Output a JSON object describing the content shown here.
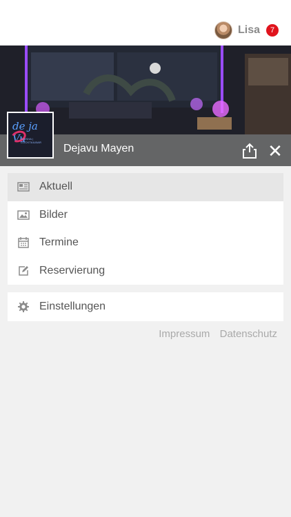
{
  "header": {
    "user_name": "Lisa",
    "notification_count": "7"
  },
  "venue": {
    "name": "Dejavu Mayen",
    "logo_text": "de ja Vu",
    "logo_subtext": "SHISHA | COCKTAILBAR"
  },
  "menu": {
    "items": [
      {
        "label": "Aktuell",
        "icon": "newspaper-icon",
        "active": true
      },
      {
        "label": "Bilder",
        "icon": "image-icon"
      },
      {
        "label": "Termine",
        "icon": "calendar-icon"
      },
      {
        "label": "Reservierung",
        "icon": "edit-icon"
      }
    ],
    "settings_label": "Einstellungen"
  },
  "footer": {
    "impressum": "Impressum",
    "datenschutz": "Datenschutz"
  }
}
